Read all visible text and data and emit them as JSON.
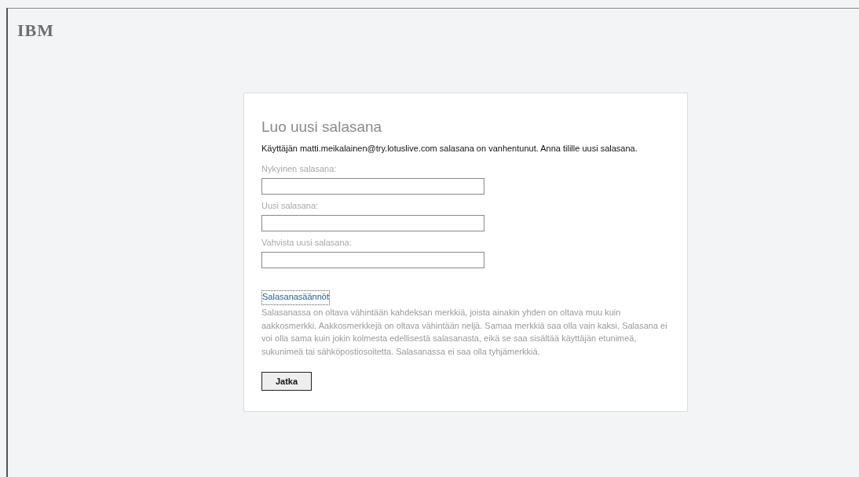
{
  "logo": "IBM",
  "form": {
    "title": "Luo uusi salasana",
    "message": "Käyttäjän matti.meikalainen@try.lotuslive.com salasana on vanhentunut. Anna tilille uusi salasana.",
    "fields": [
      {
        "label": "Nykyinen salasana:"
      },
      {
        "label": "Uusi salasana:"
      },
      {
        "label": "Vahvista uusi salasana:"
      }
    ],
    "rules_link": "Salasanasäännöt",
    "rules_text": "Salasanassa on oltava vähintään kahdeksan merkkiä, joista ainakin yhden on oltava muu kuin aakkosmerkki. Aakkosmerkkejä on oltava vähintään neljä. Samaa merkkiä saa olla vain kaksi. Salasana ei voi olla sama kuin jokin kolmesta edellisestä salasanasta, eikä se saa sisältää käyttäjän etunimeä, sukunimeä tai sähköpostiosoitetta. Salasanassa ei saa olla tyhjämerkkiä.",
    "submit": "Jatka"
  }
}
